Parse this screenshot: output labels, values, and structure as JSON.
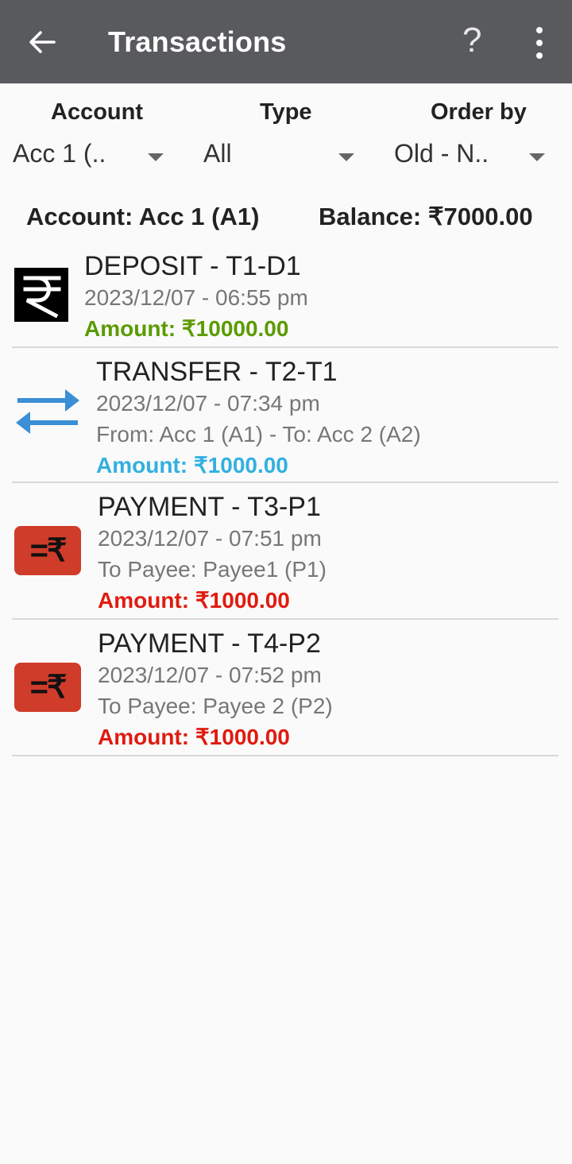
{
  "appbar": {
    "title": "Transactions",
    "help_label": "?"
  },
  "filters": {
    "account_label": "Account",
    "type_label": "Type",
    "order_label": "Order by",
    "account_value": "Acc 1 (..",
    "type_value": "All",
    "order_value": "Old - N.."
  },
  "summary": {
    "account": "Account: Acc 1 (A1)",
    "balance": "Balance: ₹7000.00"
  },
  "colors": {
    "deposit": "#5b9b00",
    "transfer": "#32b0e0",
    "payment": "#e01b0f",
    "appbar": "#595a5e"
  },
  "transactions": [
    {
      "icon": "rupee-icon",
      "name": "DEPOSIT - T1-D1",
      "datetime": "2023/12/07 - 06:55 pm",
      "amount": "Amount: ₹10000.00"
    },
    {
      "icon": "transfer-arrows-icon",
      "name": "TRANSFER - T2-T1",
      "datetime": "2023/12/07 - 07:34 pm",
      "detail": "From: Acc 1 (A1) - To: Acc 2 (A2)",
      "amount": "Amount: ₹1000.00"
    },
    {
      "icon": "payment-icon",
      "name": "PAYMENT - T3-P1",
      "datetime": "2023/12/07 - 07:51 pm",
      "detail": "To Payee: Payee1 (P1)",
      "amount": "Amount: ₹1000.00",
      "badge": "=₹"
    },
    {
      "icon": "payment-icon",
      "name": "PAYMENT - T4-P2",
      "datetime": "2023/12/07 - 07:52 pm",
      "detail": "To Payee: Payee 2 (P2)",
      "amount": "Amount: ₹1000.00",
      "badge": "=₹"
    }
  ]
}
